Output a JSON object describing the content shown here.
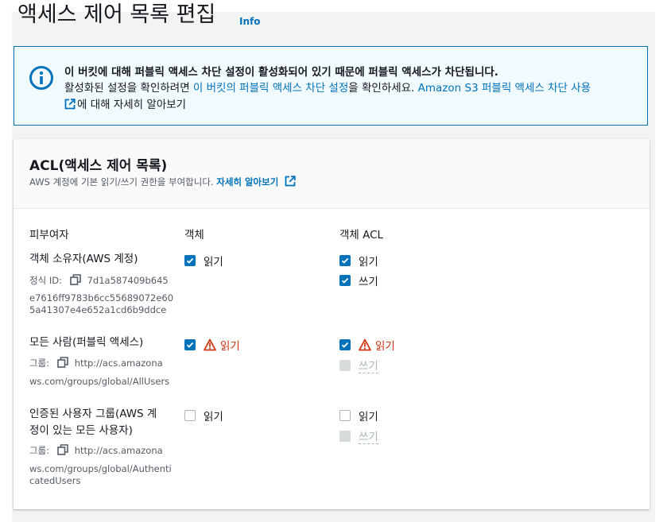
{
  "page": {
    "title": "액세스 제어 목록 편집",
    "info_label": "Info"
  },
  "alert": {
    "title": "이 버킷에 대해 퍼블릭 액세스 차단 설정이 활성화되어 있기 때문에 퍼블릭 액세스가 차단됩니다.",
    "text_before": "활성화된 설정을 확인하려면 ",
    "link_settings": "이 버킷의 퍼블릭 액세스 차단 설정",
    "text_middle": "을 확인하세요. ",
    "link_learn": "Amazon S3 퍼블릭 액세스 차단 사용",
    "text_after": "에 대해 자세히 알아보기"
  },
  "acl": {
    "title": "ACL(액세스 제어 목록)",
    "description": "AWS 계정에 기본 읽기/쓰기 권한을 부여합니다. ",
    "learn_more": "자세히 알아보기",
    "columns": {
      "grantee": "피부여자",
      "object": "객체",
      "object_acl": "객체 ACL"
    },
    "rows": [
      {
        "grantee": "객체 소유자(AWS 계정)",
        "meta_label": "정식 ID:",
        "meta_value_1": "7d1a587409b645",
        "meta_value_2": "e7616ff9783b6cc55689072e60",
        "meta_value_3": "5a41307e4e652a1cd6b9ddce",
        "object_read": "읽기",
        "acl_read": "읽기",
        "acl_write": "쓰기"
      },
      {
        "grantee": "모든 사람(퍼블릭 액세스)",
        "meta_label": "그룹:",
        "meta_value_1": "http://acs.amazona",
        "meta_value_2": "ws.com/groups/global/AllUsers",
        "object_read": "읽기",
        "acl_read": "읽기",
        "acl_write": "쓰기"
      },
      {
        "grantee_1": "인증된 사용자 그룹(AWS 계",
        "grantee_2": "정이 있는 모든 사용자)",
        "meta_label": "그룹:",
        "meta_value_1": "http://acs.amazona",
        "meta_value_2": "ws.com/groups/global/Authenti",
        "meta_value_3": "catedUsers",
        "object_read": "읽기",
        "acl_read": "읽기",
        "acl_write": "쓰기"
      }
    ]
  },
  "colors": {
    "accent": "#0073bb",
    "danger": "#d13212",
    "disabled": "#aab7b8",
    "alert_bg": "#f1faff"
  }
}
